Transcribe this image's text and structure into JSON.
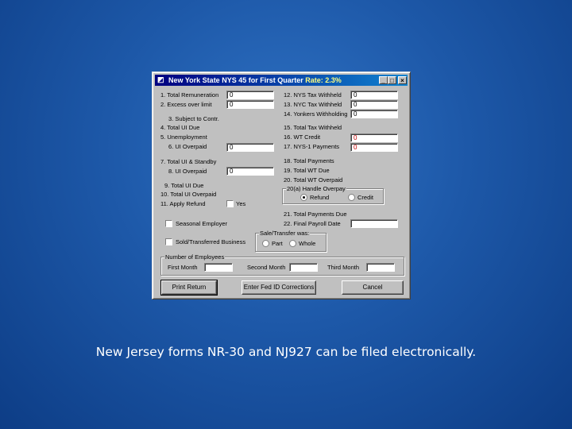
{
  "window": {
    "title": "New York State NYS 45 for First Quarter",
    "rate": "Rate: 2.3%",
    "buttons": {
      "minimize": "_",
      "maximize": "□",
      "close": "×"
    }
  },
  "left": {
    "l1": "1. Total Remuneration",
    "l1_val": "0",
    "l2": "2. Excess over limit",
    "l2_val": "0",
    "l3": "3. Subject to Contr.",
    "l4": "4. Total UI Due",
    "l5": "5. Unemployment",
    "l6": "6. UI Overpaid",
    "l6_val": "0",
    "l7": "7. Total UI & Standby",
    "l8": "8. UI Overpaid",
    "l8_val": "0",
    "l9": "9. Total UI Due",
    "l10": "10. Total UI Overpaid",
    "l11": "11. Apply Refund",
    "yes": "Yes",
    "seasonal": "Seasonal Employer",
    "sold": "Sold/Transferred Business"
  },
  "right": {
    "r12": "12. NYS Tax Withheld",
    "r12_val": "0",
    "r13": "13. NYC Tax Withheld",
    "r13_val": "0",
    "r14": "14. Yonkers Withholding",
    "r14_val": "0",
    "r15": "15. Total Tax Withheld",
    "r16": "16. WT Credit",
    "r16_val": "0",
    "r17": "17. NYS-1 Payments",
    "r17_val": "0",
    "r18": "18. Total Payments",
    "r19": "19. Total WT Due",
    "r20": "20. Total WT Overpaid",
    "overpay_title": "20(a) Handle Overpay",
    "refund": "Refund",
    "credit": "Credit",
    "r21": "21. Total Payments Due",
    "r22": "22. Final Payroll Date",
    "r22_val": ""
  },
  "sale": {
    "title": "Sale/Transfer was:",
    "part": "Part",
    "whole": "Whole"
  },
  "employees": {
    "title": "Number of Employees",
    "first": "First Month",
    "second": "Second Month",
    "third": "Third Month",
    "first_val": "",
    "second_val": "",
    "third_val": ""
  },
  "actions": {
    "print": "Print Return",
    "fid": "Enter Fed ID Corrections",
    "cancel": "Cancel"
  },
  "caption": "New Jersey forms NR-30 and NJ927 can be filed electronically."
}
